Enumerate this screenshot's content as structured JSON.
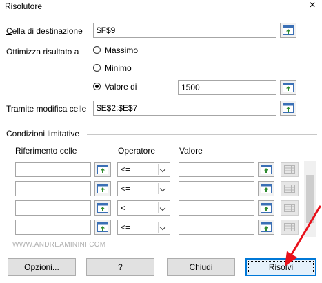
{
  "window": {
    "title": "Risolutore",
    "close_glyph": "×"
  },
  "target_cell": {
    "label": "Cella di destinazione",
    "value": "$F$9"
  },
  "optimize": {
    "label": "Ottimizza risultato a",
    "options": [
      {
        "label": "Massimo",
        "selected": false
      },
      {
        "label": "Minimo",
        "selected": false
      },
      {
        "label": "Valore di",
        "selected": true
      }
    ],
    "value_of": "1500"
  },
  "changing_cells": {
    "label": "Tramite modifica celle",
    "value": "$E$2:$E$7"
  },
  "constraints": {
    "section_label": "Condizioni limitative",
    "col_reference": "Riferimento celle",
    "col_operator": "Operatore",
    "col_value": "Valore",
    "rows": [
      {
        "reference": "",
        "operator": "<=",
        "value": ""
      },
      {
        "reference": "",
        "operator": "<=",
        "value": ""
      },
      {
        "reference": "",
        "operator": "<=",
        "value": ""
      },
      {
        "reference": "",
        "operator": "<=",
        "value": ""
      }
    ]
  },
  "watermark": "WWW.ANDREAMININI.COM",
  "buttons": {
    "options": "Opzioni...",
    "help": "?",
    "close": "Chiudi",
    "solve": "Risolvi"
  },
  "colors": {
    "annotation_arrow": "#e8101a",
    "default_button_border": "#0078d7"
  },
  "icons": {
    "shrink": "shrink-dialog-icon",
    "delete": "delete-row-icon"
  }
}
